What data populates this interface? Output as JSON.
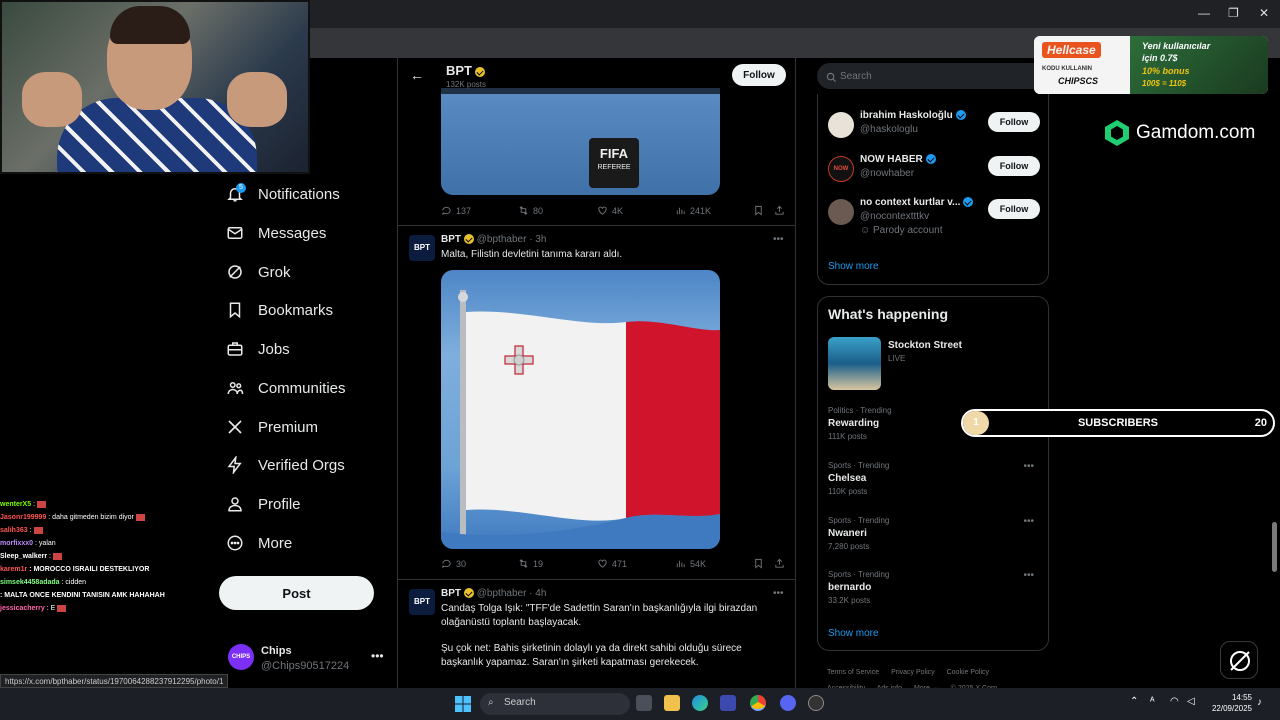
{
  "nav": {
    "items": [
      {
        "label": "Notifications",
        "badge": "5"
      },
      {
        "label": "Messages"
      },
      {
        "label": "Grok"
      },
      {
        "label": "Bookmarks"
      },
      {
        "label": "Jobs"
      },
      {
        "label": "Communities"
      },
      {
        "label": "Premium"
      },
      {
        "label": "Verified Orgs"
      },
      {
        "label": "Profile"
      },
      {
        "label": "More"
      }
    ],
    "post_label": "Post",
    "account": {
      "name": "Chips",
      "handle": "@Chips90517224",
      "avatar_text": "CHIPS"
    }
  },
  "chat": [
    {
      "user": "wenterX5",
      "msg": ":",
      "color": "#7CFC00"
    },
    {
      "user": "Jasonr199999",
      "msg": ": daha gitmeden bizim diyor",
      "color": "#ff5555"
    },
    {
      "user": "salih363",
      "msg": ":",
      "color": "#ff5555"
    },
    {
      "user": "morfixxx0",
      "msg": ": yalan",
      "color": "#c08cff"
    },
    {
      "user": "Sleep_walkerr",
      "msg": ":",
      "color": "#ffffff"
    },
    {
      "user": "karem1r",
      "msg": ": MOROCCO ISRAILI DESTEKLIYOR",
      "color": "#ff5555"
    },
    {
      "user": "simsek4458adada",
      "msg": ": cidden",
      "color": "#7fff7f"
    },
    {
      "user": "",
      "msg": ": MALTA ONCE KENDINI TANISIN AMK HAHAHAH",
      "color": "#ff5555"
    },
    {
      "user": "jessicacherry",
      "msg": ": E",
      "color": "#ff66aa"
    }
  ],
  "header": {
    "name": "BPT",
    "count": "132K posts",
    "follow_label": "Follow"
  },
  "post1": {
    "media_text_1": "FIFA",
    "media_text_2": "REFEREE",
    "stats": {
      "replies": "137",
      "reposts": "80",
      "likes": "4K",
      "views": "241K"
    }
  },
  "post2": {
    "avatar_text": "BPT",
    "name": "BPT",
    "handle": "@bpthaber",
    "time": "· 3h",
    "text": "Malta, Filistin devletini tanıma kararı aldı.",
    "stats": {
      "replies": "30",
      "reposts": "19",
      "likes": "471",
      "views": "54K"
    }
  },
  "post3": {
    "avatar_text": "BPT",
    "name": "BPT",
    "handle": "@bpthaber",
    "time": "· 4h",
    "text1": "Candaş Tolga Işık: \"TFF'de Sadettin Saran'ın başkanlığıyla ilgi birazdan olağanüstü toplantı başlayacak.",
    "text2": "Şu çok net: Bahis şirketinin dolaylı ya da direkt sahibi olduğu sürece başkanlık yapamaz. Saran'ın şirketi kapatması gerekecek."
  },
  "search": {
    "placeholder": "Search"
  },
  "who_to_follow": [
    {
      "name": "ibrahim Haskoloğlu",
      "handle": "@haskologlu",
      "extra": "",
      "follow": "Follow"
    },
    {
      "name": "NOW HABER",
      "handle": "@nowhaber",
      "extra": "",
      "follow": "Follow"
    },
    {
      "name": "no context kurtlar v...",
      "handle": "@nocontextttkv",
      "extra": "Parody account",
      "follow": "Follow"
    }
  ],
  "who_show_more": "Show more",
  "whats_happening": {
    "title": "What's happening",
    "live": {
      "name": "Stockton Street",
      "status": "LIVE"
    },
    "trends": [
      {
        "cat": "Politics · Trending",
        "name": "Rewarding",
        "count": "111K posts"
      },
      {
        "cat": "Sports · Trending",
        "name": "Chelsea",
        "count": "110K posts"
      },
      {
        "cat": "Sports · Trending",
        "name": "Nwaneri",
        "count": "7,280 posts"
      },
      {
        "cat": "Sports · Trending",
        "name": "bernardo",
        "count": "33.2K posts"
      }
    ],
    "show_more": "Show more"
  },
  "footer": {
    "links": [
      "Terms of Service",
      "Privacy Policy",
      "Cookie Policy",
      "Accessibility",
      "Ads info",
      "More ···",
      "© 2025 X Corp."
    ]
  },
  "hellcase": {
    "logo": "Hellcase",
    "code_label": "KODU KULLANIN",
    "code": "CHIPSCS",
    "line1": "Yeni kullanıcılar",
    "line2": "için 0.7$",
    "line3": "10% bonus",
    "line4": "100$ = 110$"
  },
  "gamdom": {
    "label": "Gamdom.com"
  },
  "subscribers": {
    "current": "1",
    "label": "SUBSCRIBERS",
    "goal": "20",
    "progress": 0.05
  },
  "status_url": "https://x.com/bpthaber/status/1970064288237912295/photo/1",
  "taskbar": {
    "search": "Search",
    "time": "14:55",
    "date": "22/09/2025"
  },
  "colors": {
    "accent": "#1d9bf0",
    "bg": "#000000",
    "gold_verified": "#e7c12c",
    "malta_red": "#cf142b"
  }
}
